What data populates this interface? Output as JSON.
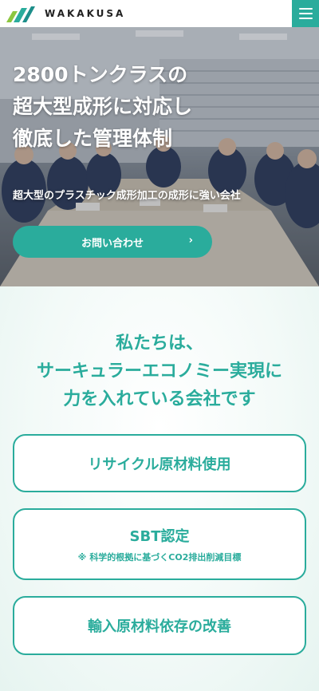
{
  "colors": {
    "accent": "#2aac9c",
    "header_bg": "#ffffff",
    "text_on_accent": "#ffffff"
  },
  "header": {
    "logo_icon": "wakakusa-leaf-logo",
    "logo_text": "WAKAKUSA",
    "menu_icon": "hamburger-menu-icon"
  },
  "hero": {
    "title_lines": [
      "2800トンクラスの",
      "超大型成形に対応し",
      "徹底した管理体制"
    ],
    "subtitle": "超大型のプラスチック成形加工の成形に強い会社",
    "cta_label": "お問い合わせ",
    "cta_arrow": "›"
  },
  "mission": {
    "heading_lines": [
      "私たちは、",
      "サーキュラーエコノミー実現に",
      "力を入れている会社です"
    ],
    "features": [
      {
        "label": "リサイクル原材料使用"
      },
      {
        "label": "SBT認定",
        "note_mark": "※",
        "note": "科学的根拠に基づくCO2排出削減目標"
      },
      {
        "label": "輸入原材料依存の改善"
      }
    ]
  }
}
